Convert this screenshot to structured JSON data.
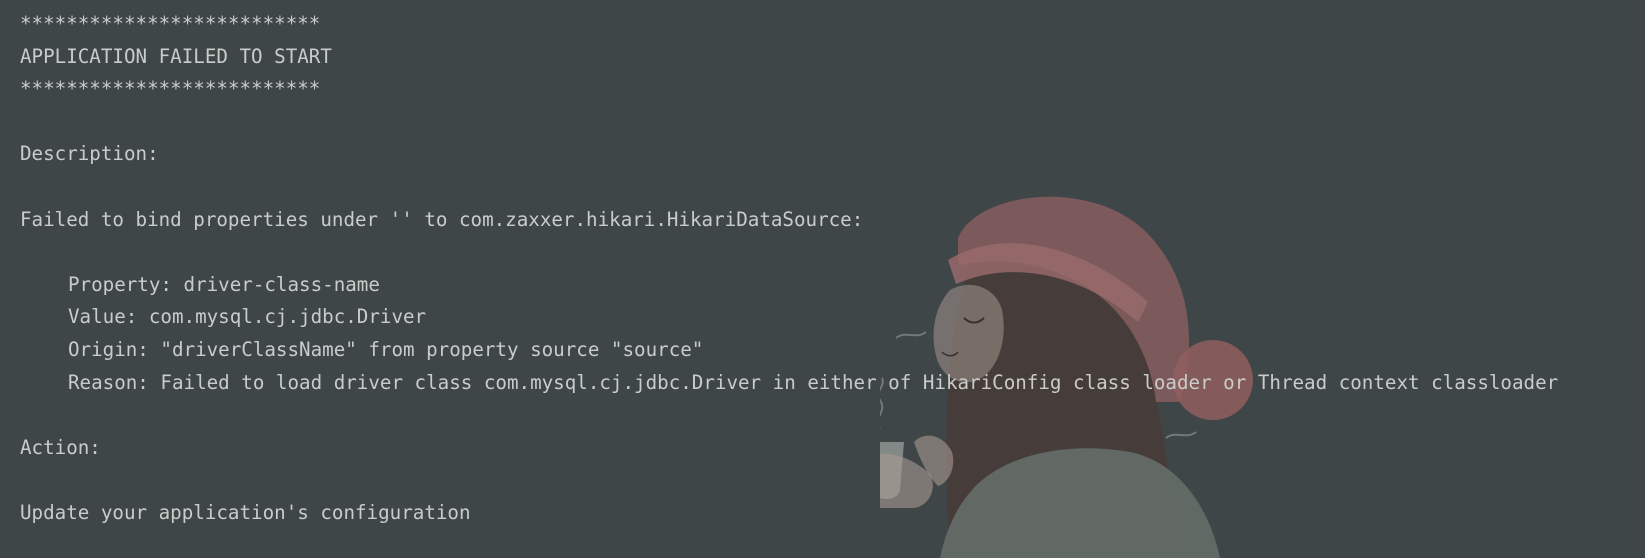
{
  "console": {
    "lines": [
      {
        "text": "**************************",
        "indent": false
      },
      {
        "text": "APPLICATION FAILED TO START",
        "indent": false
      },
      {
        "text": "**************************",
        "indent": false
      },
      {
        "text": "",
        "indent": false
      },
      {
        "text": "Description:",
        "indent": false
      },
      {
        "text": "",
        "indent": false
      },
      {
        "text": "Failed to bind properties under '' to com.zaxxer.hikari.HikariDataSource:",
        "indent": false
      },
      {
        "text": "",
        "indent": false
      },
      {
        "text": "Property: driver-class-name",
        "indent": true
      },
      {
        "text": "Value: com.mysql.cj.jdbc.Driver",
        "indent": true
      },
      {
        "text": "Origin: \"driverClassName\" from property source \"source\"",
        "indent": true
      },
      {
        "text": "Reason: Failed to load driver class com.mysql.cj.jdbc.Driver in either of HikariConfig class loader or Thread context classloader",
        "indent": true
      },
      {
        "text": "",
        "indent": false
      },
      {
        "text": "Action:",
        "indent": false
      },
      {
        "text": "",
        "indent": false
      },
      {
        "text": "Update your application's configuration",
        "indent": false
      }
    ]
  },
  "colors": {
    "background": "#3f4647",
    "text": "#c9cdca"
  }
}
